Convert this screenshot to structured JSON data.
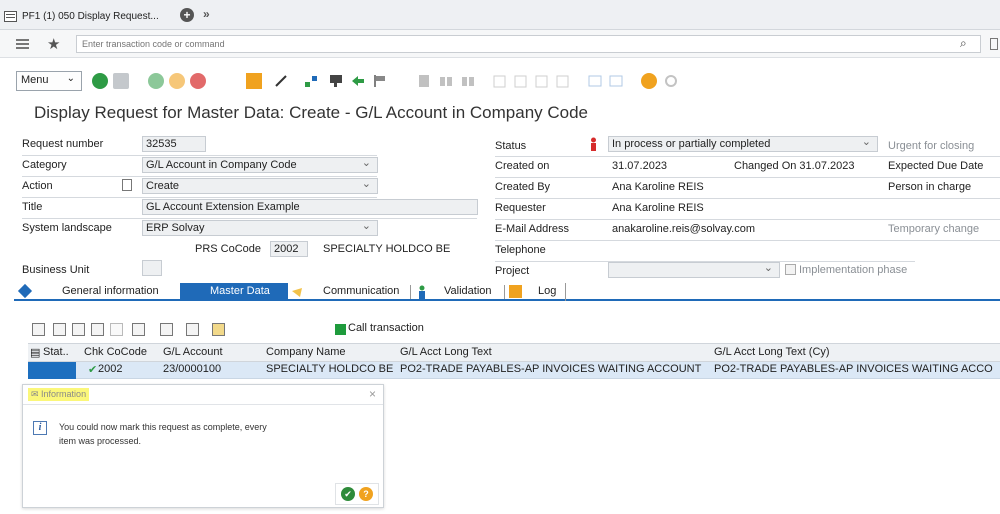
{
  "window": {
    "tab_title": "PF1 (1) 050 Display Request..."
  },
  "command": {
    "placeholder": "Enter transaction code or command"
  },
  "toolbar": {
    "menu_label": "Menu"
  },
  "page": {
    "title": "Display Request for Master Data: Create - G/L Account in Company Code"
  },
  "form": {
    "left": {
      "request_number_label": "Request number",
      "request_number": "32535",
      "category_label": "Category",
      "category": "G/L Account in Company Code",
      "action_label": "Action",
      "action": "Create",
      "title_label": "Title",
      "title": "GL Account Extension Example",
      "system_landscape_label": "System landscape",
      "system_landscape": "ERP Solvay",
      "prs_cocode_label": "PRS CoCode",
      "prs_cocode": "2002",
      "prs_cocode_name": "SPECIALTY HOLDCO BE",
      "business_unit_label": "Business Unit"
    },
    "middle": {
      "status_label": "Status",
      "status": "In process or partially completed",
      "created_on_label": "Created on",
      "created_on": "31.07.2023",
      "changed_on": "Changed On 31.07.2023",
      "created_by_label": "Created By",
      "created_by": "Ana Karoline REIS",
      "requester_label": "Requester",
      "requester": "Ana Karoline REIS",
      "email_label": "E-Mail Address",
      "email": "anakaroline.reis@solvay.com",
      "telephone_label": "Telephone",
      "project_label": "Project",
      "implementation_phase": "Implementation phase"
    },
    "right": {
      "urgent_label": "Urgent for closing",
      "expected_due_label": "Expected Due Date",
      "person_in_charge_label": "Person in charge",
      "temporary_change_label": "Temporary change"
    }
  },
  "subtabs": [
    "General information",
    "Master Data",
    "Communication",
    "Validation",
    "Log"
  ],
  "grid": {
    "call_transaction": "Call transaction",
    "columns": [
      "Stat..",
      "Chk CoCode",
      "G/L Account",
      "Company Name",
      "G/L Acct Long Text",
      "G/L Acct Long Text (Cy)"
    ],
    "rows": [
      {
        "cocode": "2002",
        "gl_account": "23/0000100",
        "company": "SPECIALTY HOLDCO BE",
        "long_text": "PO2-TRADE PAYABLES-AP INVOICES WAITING ACCOUNT",
        "long_text_cy": "PO2-TRADE PAYABLES-AP INVOICES WAITING ACCO"
      }
    ]
  },
  "dialog": {
    "title": "Information",
    "message": "You could now mark this request as complete, every item was processed."
  },
  "colors": {
    "accent": "#1f6ab8",
    "selected_row": "#dbe8f6",
    "highlight": "#fbf77a",
    "status_red": "#d62b2b"
  }
}
